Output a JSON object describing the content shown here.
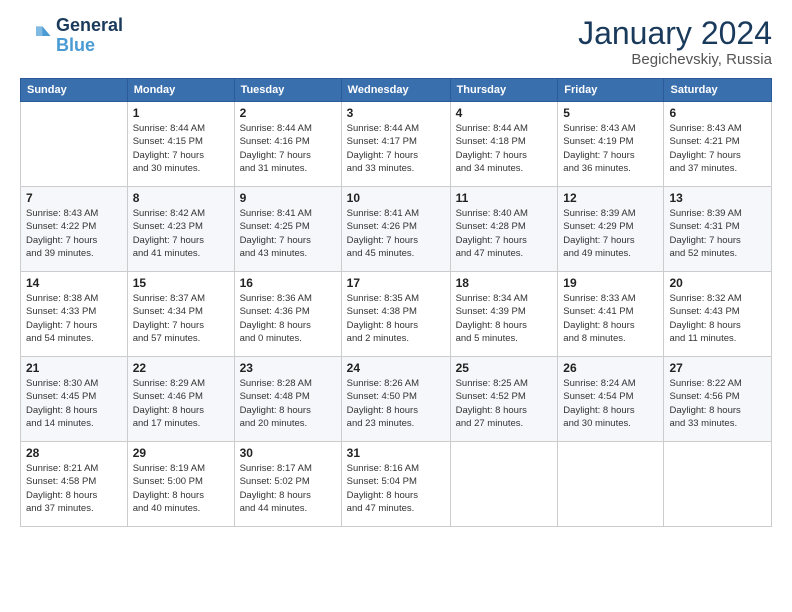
{
  "logo": {
    "line1": "General",
    "line2": "Blue"
  },
  "title": "January 2024",
  "location": "Begichevskiy, Russia",
  "days_header": [
    "Sunday",
    "Monday",
    "Tuesday",
    "Wednesday",
    "Thursday",
    "Friday",
    "Saturday"
  ],
  "weeks": [
    [
      {
        "day": "",
        "info": ""
      },
      {
        "day": "1",
        "info": "Sunrise: 8:44 AM\nSunset: 4:15 PM\nDaylight: 7 hours\nand 30 minutes."
      },
      {
        "day": "2",
        "info": "Sunrise: 8:44 AM\nSunset: 4:16 PM\nDaylight: 7 hours\nand 31 minutes."
      },
      {
        "day": "3",
        "info": "Sunrise: 8:44 AM\nSunset: 4:17 PM\nDaylight: 7 hours\nand 33 minutes."
      },
      {
        "day": "4",
        "info": "Sunrise: 8:44 AM\nSunset: 4:18 PM\nDaylight: 7 hours\nand 34 minutes."
      },
      {
        "day": "5",
        "info": "Sunrise: 8:43 AM\nSunset: 4:19 PM\nDaylight: 7 hours\nand 36 minutes."
      },
      {
        "day": "6",
        "info": "Sunrise: 8:43 AM\nSunset: 4:21 PM\nDaylight: 7 hours\nand 37 minutes."
      }
    ],
    [
      {
        "day": "7",
        "info": "Sunrise: 8:43 AM\nSunset: 4:22 PM\nDaylight: 7 hours\nand 39 minutes."
      },
      {
        "day": "8",
        "info": "Sunrise: 8:42 AM\nSunset: 4:23 PM\nDaylight: 7 hours\nand 41 minutes."
      },
      {
        "day": "9",
        "info": "Sunrise: 8:41 AM\nSunset: 4:25 PM\nDaylight: 7 hours\nand 43 minutes."
      },
      {
        "day": "10",
        "info": "Sunrise: 8:41 AM\nSunset: 4:26 PM\nDaylight: 7 hours\nand 45 minutes."
      },
      {
        "day": "11",
        "info": "Sunrise: 8:40 AM\nSunset: 4:28 PM\nDaylight: 7 hours\nand 47 minutes."
      },
      {
        "day": "12",
        "info": "Sunrise: 8:39 AM\nSunset: 4:29 PM\nDaylight: 7 hours\nand 49 minutes."
      },
      {
        "day": "13",
        "info": "Sunrise: 8:39 AM\nSunset: 4:31 PM\nDaylight: 7 hours\nand 52 minutes."
      }
    ],
    [
      {
        "day": "14",
        "info": "Sunrise: 8:38 AM\nSunset: 4:33 PM\nDaylight: 7 hours\nand 54 minutes."
      },
      {
        "day": "15",
        "info": "Sunrise: 8:37 AM\nSunset: 4:34 PM\nDaylight: 7 hours\nand 57 minutes."
      },
      {
        "day": "16",
        "info": "Sunrise: 8:36 AM\nSunset: 4:36 PM\nDaylight: 8 hours\nand 0 minutes."
      },
      {
        "day": "17",
        "info": "Sunrise: 8:35 AM\nSunset: 4:38 PM\nDaylight: 8 hours\nand 2 minutes."
      },
      {
        "day": "18",
        "info": "Sunrise: 8:34 AM\nSunset: 4:39 PM\nDaylight: 8 hours\nand 5 minutes."
      },
      {
        "day": "19",
        "info": "Sunrise: 8:33 AM\nSunset: 4:41 PM\nDaylight: 8 hours\nand 8 minutes."
      },
      {
        "day": "20",
        "info": "Sunrise: 8:32 AM\nSunset: 4:43 PM\nDaylight: 8 hours\nand 11 minutes."
      }
    ],
    [
      {
        "day": "21",
        "info": "Sunrise: 8:30 AM\nSunset: 4:45 PM\nDaylight: 8 hours\nand 14 minutes."
      },
      {
        "day": "22",
        "info": "Sunrise: 8:29 AM\nSunset: 4:46 PM\nDaylight: 8 hours\nand 17 minutes."
      },
      {
        "day": "23",
        "info": "Sunrise: 8:28 AM\nSunset: 4:48 PM\nDaylight: 8 hours\nand 20 minutes."
      },
      {
        "day": "24",
        "info": "Sunrise: 8:26 AM\nSunset: 4:50 PM\nDaylight: 8 hours\nand 23 minutes."
      },
      {
        "day": "25",
        "info": "Sunrise: 8:25 AM\nSunset: 4:52 PM\nDaylight: 8 hours\nand 27 minutes."
      },
      {
        "day": "26",
        "info": "Sunrise: 8:24 AM\nSunset: 4:54 PM\nDaylight: 8 hours\nand 30 minutes."
      },
      {
        "day": "27",
        "info": "Sunrise: 8:22 AM\nSunset: 4:56 PM\nDaylight: 8 hours\nand 33 minutes."
      }
    ],
    [
      {
        "day": "28",
        "info": "Sunrise: 8:21 AM\nSunset: 4:58 PM\nDaylight: 8 hours\nand 37 minutes."
      },
      {
        "day": "29",
        "info": "Sunrise: 8:19 AM\nSunset: 5:00 PM\nDaylight: 8 hours\nand 40 minutes."
      },
      {
        "day": "30",
        "info": "Sunrise: 8:17 AM\nSunset: 5:02 PM\nDaylight: 8 hours\nand 44 minutes."
      },
      {
        "day": "31",
        "info": "Sunrise: 8:16 AM\nSunset: 5:04 PM\nDaylight: 8 hours\nand 47 minutes."
      },
      {
        "day": "",
        "info": ""
      },
      {
        "day": "",
        "info": ""
      },
      {
        "day": "",
        "info": ""
      }
    ]
  ]
}
